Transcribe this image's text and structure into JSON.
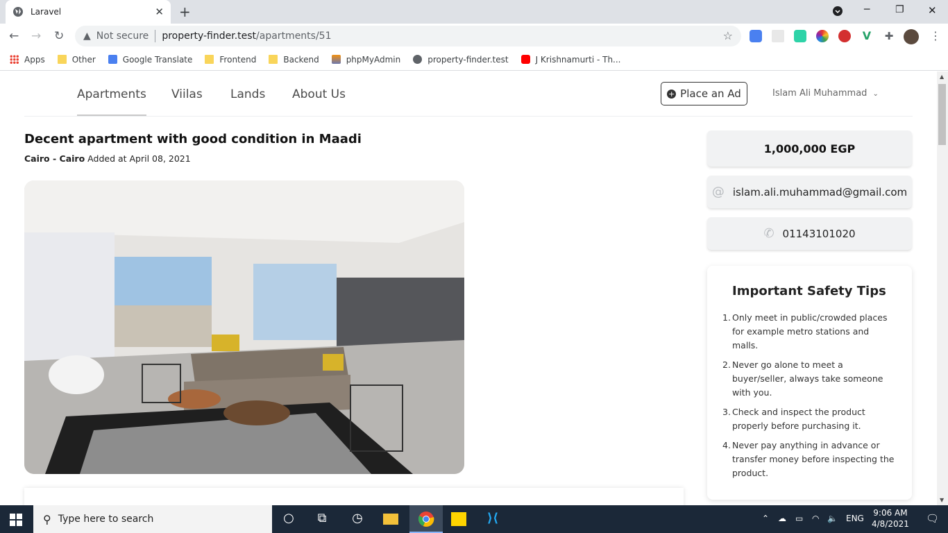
{
  "browser": {
    "tab_title": "Laravel",
    "not_secure": "Not secure",
    "url_host": "property-finder.test",
    "url_path": "/apartments/51"
  },
  "bookmarks": [
    {
      "label": "Apps",
      "icon": "apps-grid-icon"
    },
    {
      "label": "Other",
      "icon": "folder-icon"
    },
    {
      "label": "Google Translate",
      "icon": "google-translate-icon"
    },
    {
      "label": "Frontend",
      "icon": "folder-icon"
    },
    {
      "label": "Backend",
      "icon": "folder-icon"
    },
    {
      "label": "phpMyAdmin",
      "icon": "phpmyadmin-icon"
    },
    {
      "label": "property-finder.test",
      "icon": "globe-icon"
    },
    {
      "label": "J Krishnamurti - Th...",
      "icon": "youtube-icon"
    }
  ],
  "nav": {
    "items": [
      "Apartments",
      "Viilas",
      "Lands",
      "About Us"
    ],
    "place_ad": "Place an Ad",
    "user_name": "Islam Ali Muhammad"
  },
  "listing": {
    "title": "Decent apartment with good condition in Maadi",
    "location": "Cairo - Cairo",
    "added": "Added at April 08, 2021",
    "price": "1,000,000 EGP",
    "email": "islam.ali.muhammad@gmail.com",
    "phone": "01143101020"
  },
  "safety": {
    "heading": "Important Safety Tips",
    "tips": [
      "Only meet in public/crowded places for example metro stations and malls.",
      "Never go alone to meet a buyer/seller, always take someone with you.",
      "Check and inspect the product properly before purchasing it.",
      "Never pay anything in advance or transfer money before inspecting the product."
    ]
  },
  "taskbar": {
    "search_placeholder": "Type here to search",
    "lang": "ENG",
    "time": "9:06 AM",
    "date": "4/8/2021"
  }
}
